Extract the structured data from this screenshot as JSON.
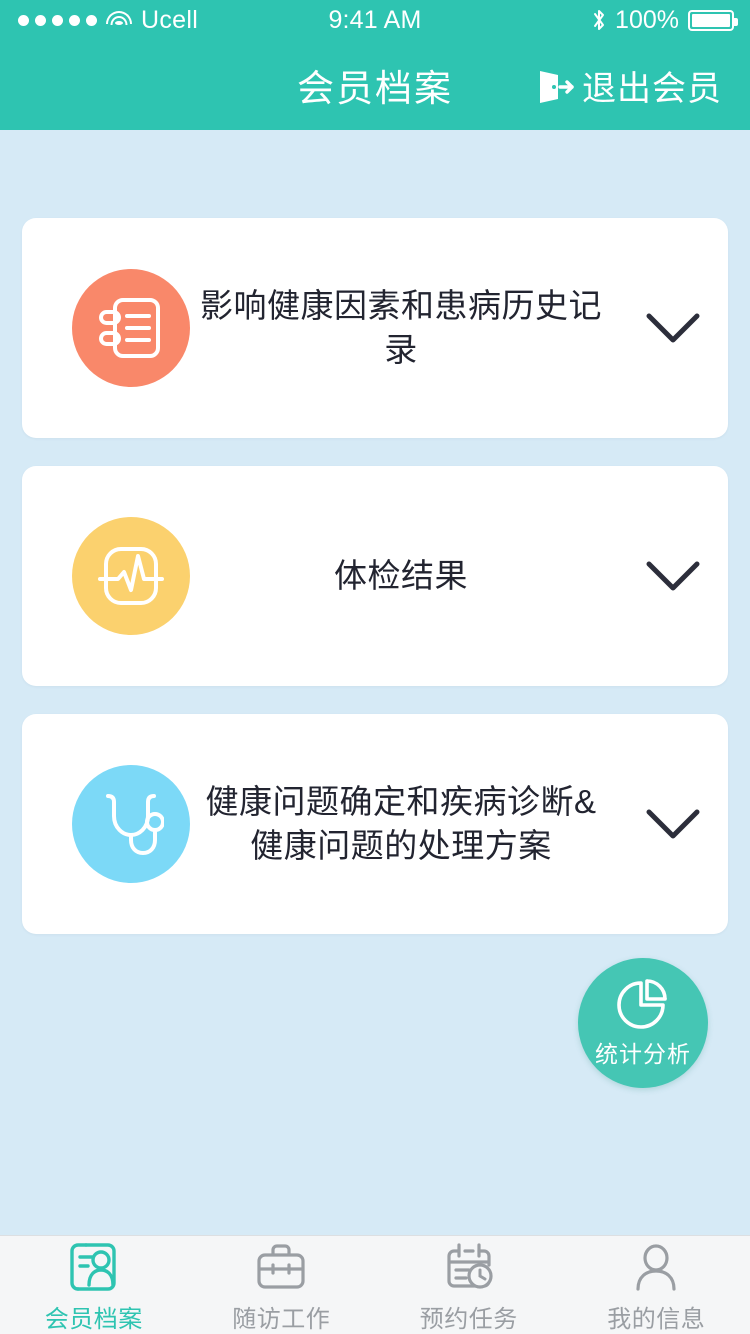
{
  "statusbar": {
    "carrier": "Ucell",
    "time": "9:41 AM",
    "battery_pct": "100%",
    "signal_dots": 5,
    "icons": {
      "wifi": "wifi-icon",
      "bluetooth": "bluetooth-icon",
      "battery": "battery-icon"
    }
  },
  "navbar": {
    "title": "会员档案",
    "action_label": "退出会员",
    "action_icon": "exit-door-icon",
    "background": "#2ec4b1",
    "text_color": "#ffffff"
  },
  "page": {
    "background": "#d6eaf6"
  },
  "cards": [
    {
      "title": "影响健康因素和患病历史记录",
      "icon": "notebook-icon",
      "icon_bg": "#f9886a",
      "chevron": "chevron-down-icon"
    },
    {
      "title": "体检结果",
      "icon": "heartbeat-monitor-icon",
      "icon_bg": "#fbd16e",
      "chevron": "chevron-down-icon"
    },
    {
      "title": "健康问题确定和疾病诊断&健康问题的处理方案",
      "icon": "stethoscope-icon",
      "icon_bg": "#7cd9f7",
      "chevron": "chevron-down-icon"
    }
  ],
  "fab": {
    "label": "统计分析",
    "icon": "pie-chart-icon",
    "background": "#45c6b4"
  },
  "tabbar": {
    "active_color": "#2ec4b1",
    "inactive_color": "#9a9ea3",
    "items": [
      {
        "label": "会员档案",
        "icon": "member-profile-icon",
        "active": true
      },
      {
        "label": "随访工作",
        "icon": "briefcase-icon",
        "active": false
      },
      {
        "label": "预约任务",
        "icon": "calendar-clock-icon",
        "active": false
      },
      {
        "label": "我的信息",
        "icon": "person-icon",
        "active": false
      }
    ]
  }
}
